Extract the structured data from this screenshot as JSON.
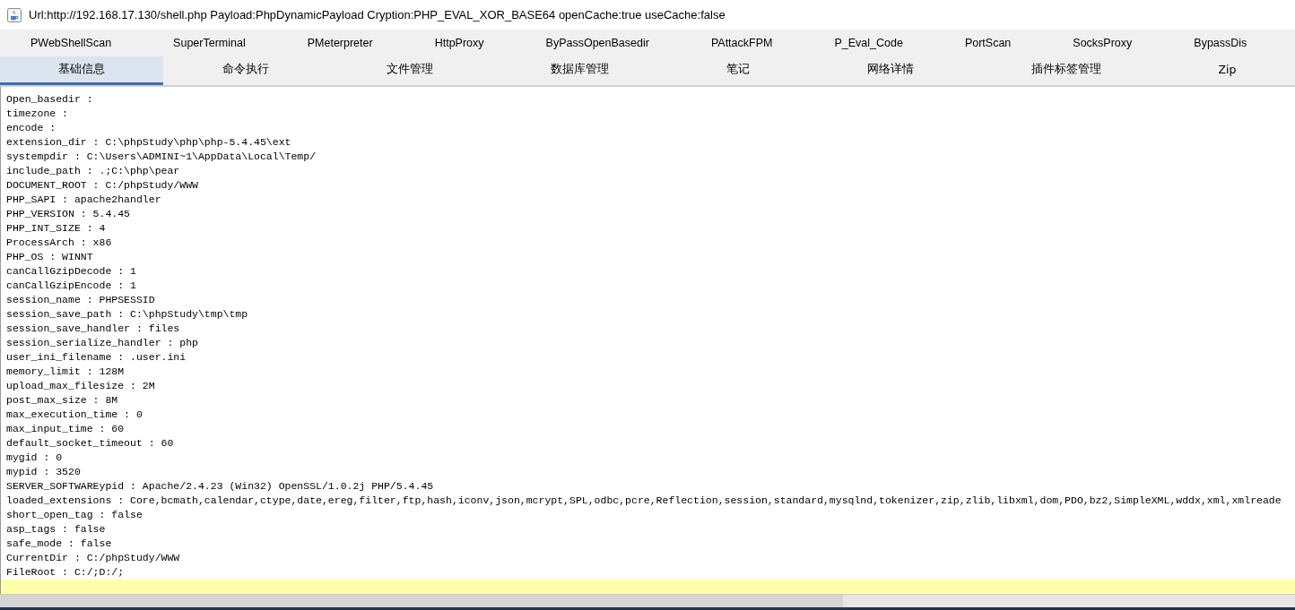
{
  "window": {
    "title": "Url:http://192.168.17.130/shell.php Payload:PhpDynamicPayload Cryption:PHP_EVAL_XOR_BASE64 openCache:true useCache:false"
  },
  "plugin_tabs": [
    {
      "label": "PWebShellScan"
    },
    {
      "label": "SuperTerminal"
    },
    {
      "label": "PMeterpreter"
    },
    {
      "label": "HttpProxy"
    },
    {
      "label": "ByPassOpenBasedir"
    },
    {
      "label": "PAttackFPM"
    },
    {
      "label": "P_Eval_Code"
    },
    {
      "label": "PortScan"
    },
    {
      "label": "SocksProxy"
    },
    {
      "label": "BypassDis"
    }
  ],
  "tabs": [
    {
      "label": "基础信息",
      "selected": true
    },
    {
      "label": "命令执行",
      "selected": false
    },
    {
      "label": "文件管理",
      "selected": false
    },
    {
      "label": "数据库管理",
      "selected": false
    },
    {
      "label": "笔记",
      "selected": false
    },
    {
      "label": "网络详情",
      "selected": false
    },
    {
      "label": "插件标签管理",
      "selected": false
    },
    {
      "label": "Zip",
      "selected": false
    }
  ],
  "lines": [
    "Open_basedir : ",
    "timezone : ",
    "encode : ",
    "extension_dir : C:\\phpStudy\\php\\php-5.4.45\\ext",
    "systempdir : C:\\Users\\ADMINI~1\\AppData\\Local\\Temp/",
    "include_path : .;C:\\php\\pear",
    "DOCUMENT_ROOT : C:/phpStudy/WWW",
    "PHP_SAPI : apache2handler",
    "PHP_VERSION : 5.4.45",
    "PHP_INT_SIZE : 4",
    "ProcessArch : x86",
    "PHP_OS : WINNT",
    "canCallGzipDecode : 1",
    "canCallGzipEncode : 1",
    "session_name : PHPSESSID",
    "session_save_path : C:\\phpStudy\\tmp\\tmp",
    "session_save_handler : files",
    "session_serialize_handler : php",
    "user_ini_filename : .user.ini",
    "memory_limit : 128M",
    "upload_max_filesize : 2M",
    "post_max_size : 8M",
    "max_execution_time : 0",
    "max_input_time : 60",
    "default_socket_timeout : 60",
    "mygid : 0",
    "mypid : 3520",
    "SERVER_SOFTWAREypid : Apache/2.4.23 (Win32) OpenSSL/1.0.2j PHP/5.4.45",
    "loaded_extensions : Core,bcmath,calendar,ctype,date,ereg,filter,ftp,hash,iconv,json,mcrypt,SPL,odbc,pcre,Reflection,session,standard,mysqlnd,tokenizer,zip,zlib,libxml,dom,PDO,bz2,SimpleXML,wddx,xml,xmlreade",
    "short_open_tag : false",
    "asp_tags : false",
    "safe_mode : false",
    "CurrentDir : C:/phpStudy/WWW",
    "FileRoot : C:/;D:/;"
  ]
}
